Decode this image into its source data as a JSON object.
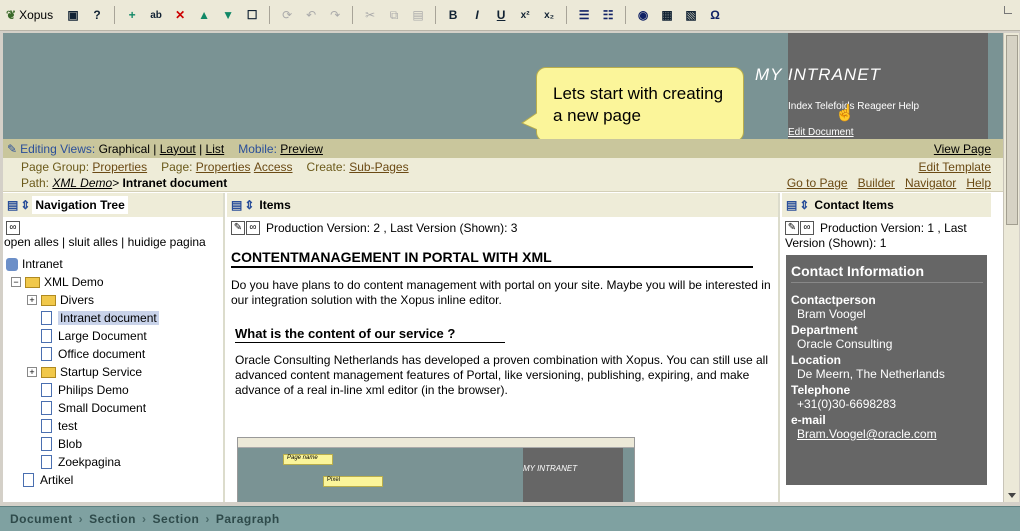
{
  "toolbar": {
    "brand": "Xopus",
    "buttons": [
      {
        "name": "save-icon",
        "glyph": "▣"
      },
      {
        "name": "help-icon",
        "glyph": "?"
      },
      {
        "name": "insert-element-icon",
        "glyph": "+"
      },
      {
        "name": "insert-attribute-icon",
        "glyph": "ab"
      },
      {
        "name": "delete-icon",
        "glyph": "✕"
      },
      {
        "name": "move-up-icon",
        "glyph": "▲"
      },
      {
        "name": "move-down-icon",
        "glyph": "▼"
      },
      {
        "name": "properties-icon",
        "glyph": "☐"
      },
      {
        "name": "refresh-icon",
        "glyph": "⟳"
      },
      {
        "name": "undo-icon",
        "glyph": "↶"
      },
      {
        "name": "redo-icon",
        "glyph": "↷"
      },
      {
        "name": "cut-icon",
        "glyph": "✂"
      },
      {
        "name": "copy-icon",
        "glyph": "⧉"
      },
      {
        "name": "paste-icon",
        "glyph": "▤"
      },
      {
        "name": "bold-icon",
        "glyph": "B"
      },
      {
        "name": "italic-icon",
        "glyph": "I"
      },
      {
        "name": "underline-icon",
        "glyph": "U"
      },
      {
        "name": "superscript-icon",
        "glyph": "x²"
      },
      {
        "name": "subscript-icon",
        "glyph": "x₂"
      },
      {
        "name": "bullet-list-icon",
        "glyph": "☰"
      },
      {
        "name": "numbered-list-icon",
        "glyph": "☷"
      },
      {
        "name": "link-icon",
        "glyph": "◉"
      },
      {
        "name": "table-icon",
        "glyph": "▦"
      },
      {
        "name": "image-icon",
        "glyph": "▧"
      },
      {
        "name": "symbol-icon",
        "glyph": "Ω"
      }
    ]
  },
  "banner": {
    "title": "MY  INTRANET",
    "nav": "Index Telefoids Reageer Help",
    "edit_document": "Edit Document"
  },
  "tooltip": {
    "text": "Lets start with creating a new page"
  },
  "editing_bar": {
    "label": "Editing Views:",
    "graphical": "Graphical",
    "layout": "Layout",
    "list": "List",
    "mobile_label": "Mobile:",
    "preview": "Preview",
    "view_page": "View Page"
  },
  "page_group_bar": {
    "page_group_label": "Page Group:",
    "page_group_properties": "Properties",
    "page_label": "Page:",
    "page_properties": "Properties",
    "access": "Access",
    "create_label": "Create:",
    "sub_pages": "Sub-Pages",
    "edit_template": "Edit Template"
  },
  "path_bar": {
    "label": "Path:",
    "path_link": "XML Demo",
    "separator": ">",
    "current": "Intranet document",
    "go_to_page": "Go to Page",
    "builder": "Builder",
    "navigator": "Navigator",
    "help": "Help"
  },
  "nav_tree": {
    "title": "Navigation Tree",
    "links": "open alles | sluit alles | huidige pagina",
    "items": [
      {
        "label": "Intranet",
        "kind": "root",
        "indent": 0
      },
      {
        "label": "XML Demo",
        "kind": "folder-open",
        "indent": 0
      },
      {
        "label": "Divers",
        "kind": "folder",
        "indent": 1
      },
      {
        "label": "Intranet document",
        "kind": "doc-selected",
        "indent": 1
      },
      {
        "label": "Large Document",
        "kind": "doc",
        "indent": 1
      },
      {
        "label": "Office document",
        "kind": "doc",
        "indent": 1
      },
      {
        "label": "Startup Service",
        "kind": "folder",
        "indent": 1
      },
      {
        "label": "Philips Demo",
        "kind": "doc",
        "indent": 1
      },
      {
        "label": "Small Document",
        "kind": "doc",
        "indent": 1
      },
      {
        "label": "test",
        "kind": "doc",
        "indent": 1
      },
      {
        "label": "Blob",
        "kind": "doc",
        "indent": 1
      },
      {
        "label": "Zoekpagina",
        "kind": "doc",
        "indent": 1
      },
      {
        "label": "Artikel",
        "kind": "doc",
        "indent": 0
      }
    ]
  },
  "items_panel": {
    "title": "Items",
    "version": "Production Version: 2 , Last Version (Shown): 3",
    "heading": "CONTENTMANAGEMENT IN PORTAL WITH XML",
    "intro": "Do you have plans to do content management with portal on your site. Maybe you will be interested in our integration solution with the Xopus inline editor.",
    "subheading": "What is the content of our service ?",
    "body": "Oracle Consulting Netherlands has developed a proven combination with Xopus. You can still use all advanced content management features of Portal, like versioning, publishing, expiring, and make advance of a real in-line xml editor (in the browser).",
    "thumbnail": {
      "title": "MY  INTRANET",
      "tip1": "Page name",
      "tip2": "Pixel"
    }
  },
  "contact_panel": {
    "title": "Contact Items",
    "version": "Production Version: 1 , Last Version (Shown): 1",
    "heading": "Contact Information",
    "fields": [
      {
        "key": "Contactperson",
        "value": "Bram Voogel"
      },
      {
        "key": "Department",
        "value": "Oracle Consulting"
      },
      {
        "key": "Location",
        "value": "De Meern, The Netherlands"
      },
      {
        "key": "Telephone",
        "value": "+31(0)30-6698283"
      },
      {
        "key": "e-mail",
        "value": "Bram.Voogel@oracle.com"
      }
    ]
  },
  "statusbar": {
    "crumbs": [
      "Document",
      "Section",
      "Section",
      "Paragraph"
    ],
    "separator": "›"
  }
}
